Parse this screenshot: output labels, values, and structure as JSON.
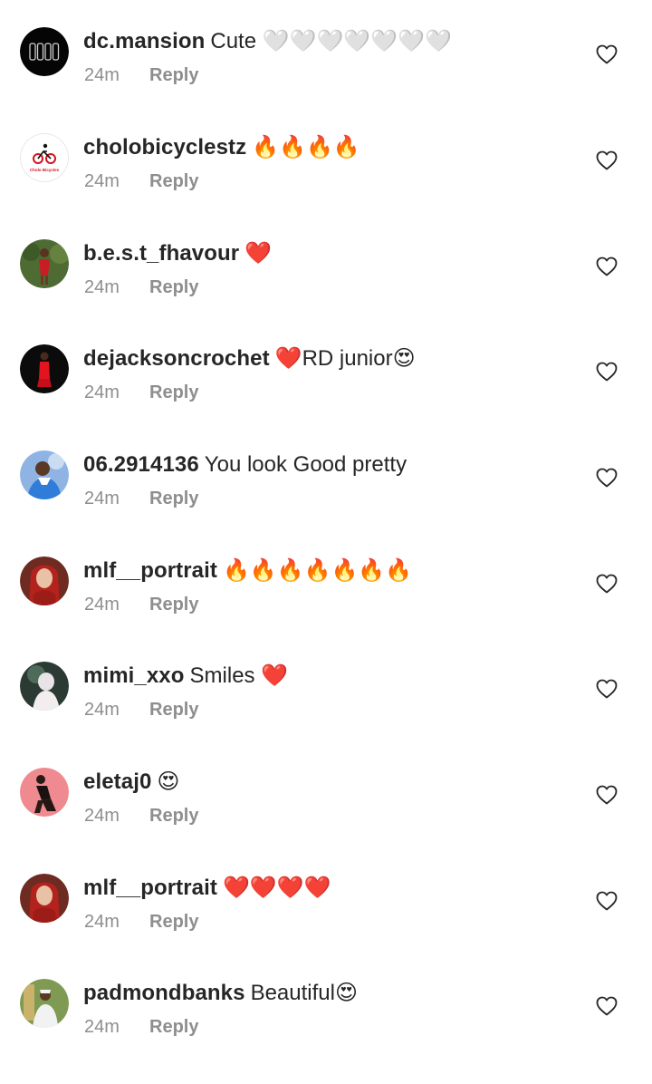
{
  "comments": [
    {
      "username": "dc.mansion",
      "text": "Cute 🤍🤍🤍🤍🤍🤍🤍",
      "time": "24m",
      "reply": "Reply"
    },
    {
      "username": "cholobicyclestz",
      "text": "🔥🔥🔥🔥",
      "time": "24m",
      "reply": "Reply",
      "avatar_text": "Cholo Bicycles"
    },
    {
      "username": "b.e.s.t_fhavour",
      "text": "❤️",
      "time": "24m",
      "reply": "Reply"
    },
    {
      "username": "dejacksoncrochet",
      "text": "❤️RD junior😍",
      "time": "24m",
      "reply": "Reply"
    },
    {
      "username": "06.2914136",
      "text": "You look Good pretty",
      "time": "24m",
      "reply": "Reply"
    },
    {
      "username": "mlf__portrait",
      "text": "🔥🔥🔥🔥🔥🔥🔥",
      "time": "24m",
      "reply": "Reply"
    },
    {
      "username": "mimi_xxo",
      "text": "Smiles ❤️",
      "time": "24m",
      "reply": "Reply"
    },
    {
      "username": "eletaj0",
      "text": "😍",
      "time": "24m",
      "reply": "Reply"
    },
    {
      "username": "mlf__portrait",
      "text": "❤️❤️❤️❤️",
      "time": "24m",
      "reply": "Reply"
    },
    {
      "username": "padmondbanks",
      "text": "Beautiful😍",
      "time": "24m",
      "reply": "Reply"
    }
  ],
  "icons": {
    "like": "heart-outline-icon"
  },
  "colors": {
    "text": "#262626",
    "secondary": "#8e8e8e",
    "background": "#ffffff"
  }
}
